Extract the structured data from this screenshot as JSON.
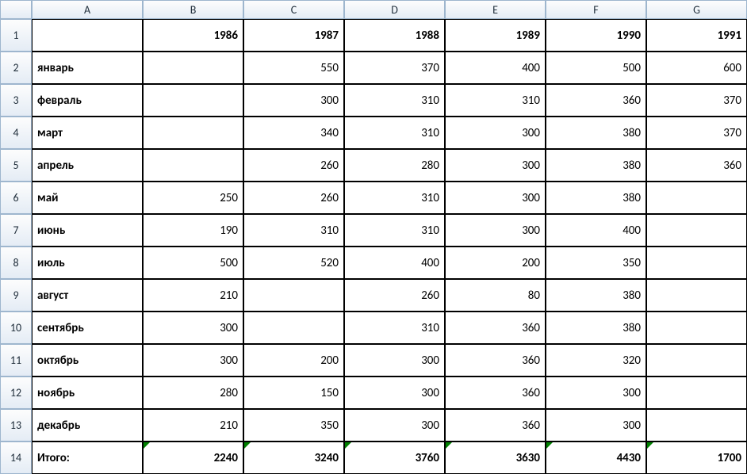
{
  "columns": [
    "A",
    "B",
    "C",
    "D",
    "E",
    "F",
    "G"
  ],
  "row_numbers": [
    "1",
    "2",
    "3",
    "4",
    "5",
    "6",
    "7",
    "8",
    "9",
    "10",
    "11",
    "12",
    "13",
    "14"
  ],
  "header_row": {
    "A": "",
    "B": "1986",
    "C": "1987",
    "D": "1988",
    "E": "1989",
    "F": "1990",
    "G": "1991"
  },
  "rows": [
    {
      "label": "январь",
      "B": "",
      "C": "550",
      "D": "370",
      "E": "400",
      "F": "500",
      "G": "600"
    },
    {
      "label": "февраль",
      "B": "",
      "C": "300",
      "D": "310",
      "E": "310",
      "F": "360",
      "G": "370"
    },
    {
      "label": "март",
      "B": "",
      "C": "340",
      "D": "310",
      "E": "300",
      "F": "380",
      "G": "370"
    },
    {
      "label": "апрель",
      "B": "",
      "C": "260",
      "D": "280",
      "E": "300",
      "F": "380",
      "G": "360"
    },
    {
      "label": "май",
      "B": "250",
      "C": "260",
      "D": "310",
      "E": "300",
      "F": "380",
      "G": ""
    },
    {
      "label": "июнь",
      "B": "190",
      "C": "310",
      "D": "310",
      "E": "300",
      "F": "400",
      "G": ""
    },
    {
      "label": "июль",
      "B": "500",
      "C": "520",
      "D": "400",
      "E": "200",
      "F": "350",
      "G": ""
    },
    {
      "label": "август",
      "B": "210",
      "C": "",
      "D": "260",
      "E": "80",
      "F": "380",
      "G": ""
    },
    {
      "label": "сентябрь",
      "B": "300",
      "C": "",
      "D": "310",
      "E": "360",
      "F": "380",
      "G": ""
    },
    {
      "label": "октябрь",
      "B": "300",
      "C": "200",
      "D": "300",
      "E": "360",
      "F": "320",
      "G": ""
    },
    {
      "label": "ноябрь",
      "B": "280",
      "C": "150",
      "D": "300",
      "E": "360",
      "F": "300",
      "G": ""
    },
    {
      "label": "декабрь",
      "B": "210",
      "C": "350",
      "D": "300",
      "E": "360",
      "F": "300",
      "G": ""
    }
  ],
  "totals": {
    "label": "Итого:",
    "B": "2240",
    "C": "3240",
    "D": "3760",
    "E": "3630",
    "F": "4430",
    "G": "1700"
  }
}
